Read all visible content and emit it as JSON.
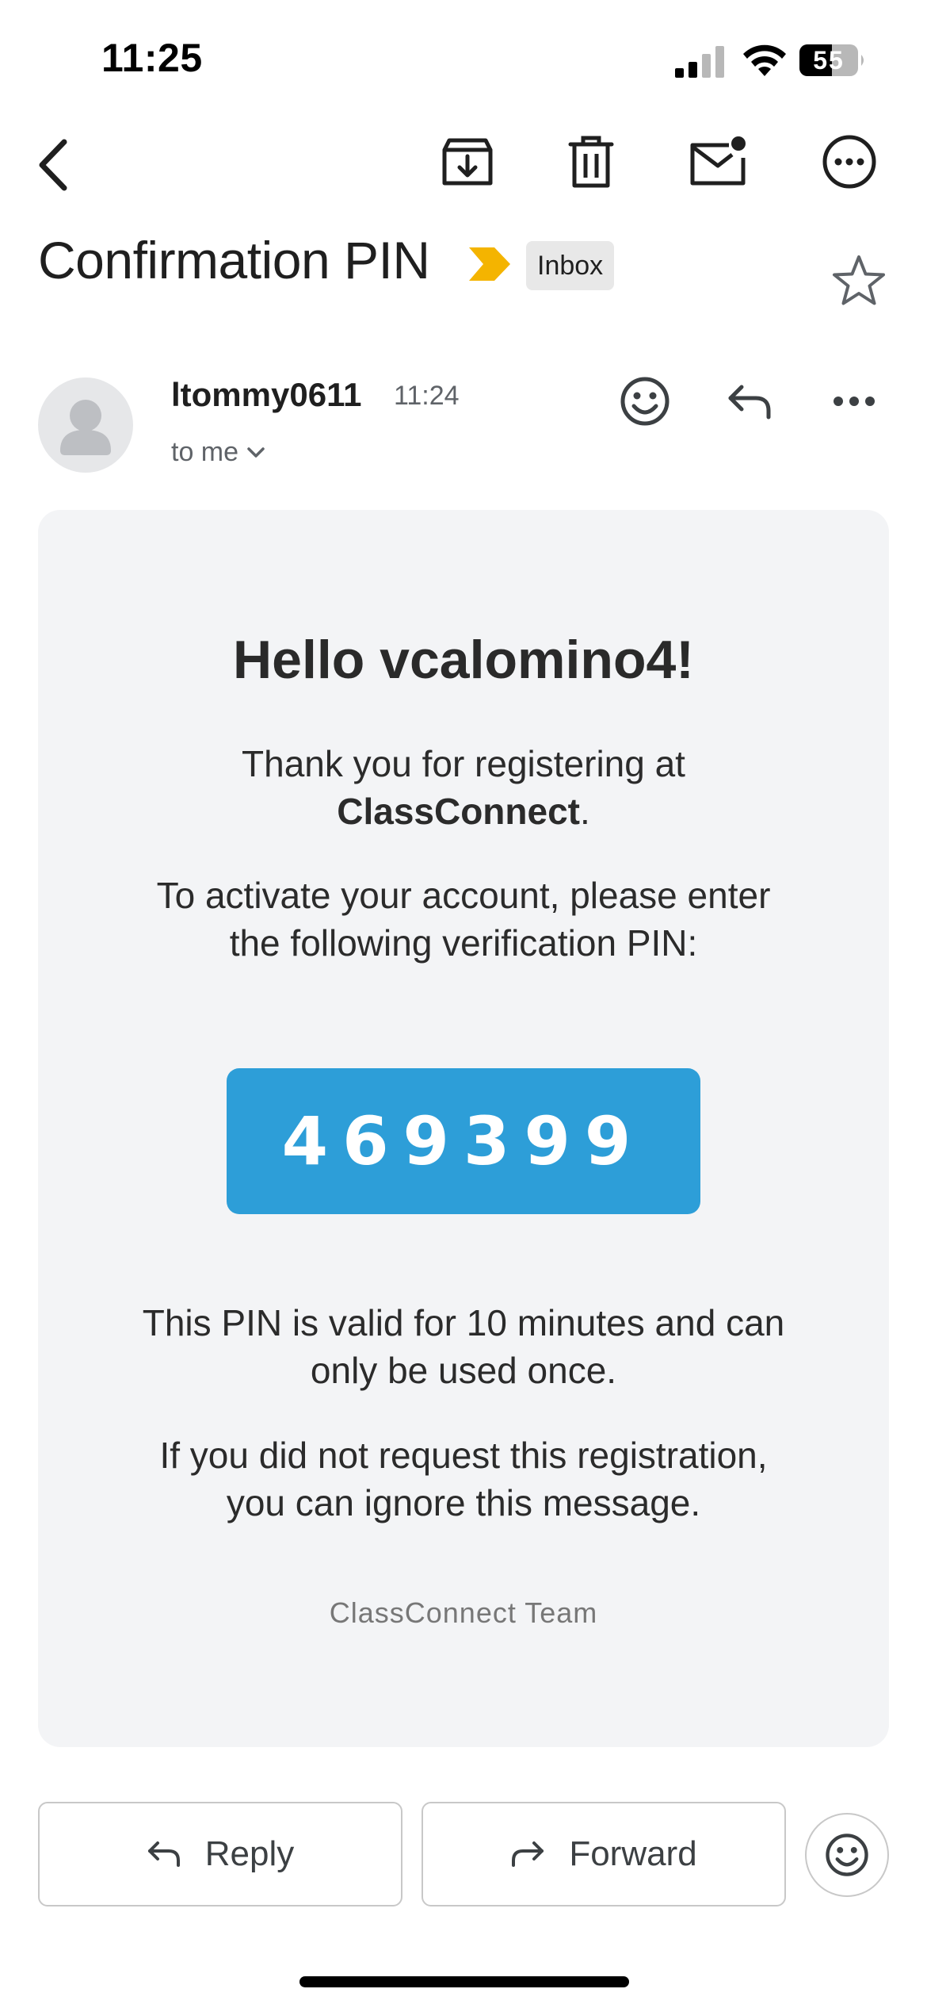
{
  "status_bar": {
    "time": "11:25",
    "battery": "55"
  },
  "toolbar": {
    "back": "back",
    "archive": "archive",
    "delete": "delete",
    "mark_unread": "mark unread",
    "more": "more options"
  },
  "email": {
    "subject": "Confirmation PIN",
    "label": "Inbox",
    "sender": "ltommy0611",
    "time": "11:24",
    "recipient": "to me"
  },
  "body": {
    "greeting": "Hello vcalomino4!",
    "thanks_line1": "Thank you for registering at",
    "brand": "ClassConnect",
    "brand_suffix": ".",
    "activate_line1": "To activate your account, please enter",
    "activate_line2": "the following verification PIN:",
    "pin": "469399",
    "valid_line1": "This PIN is valid for 10 minutes and can",
    "valid_line2": "only be used once.",
    "ignore_line1": "If you did not request this registration,",
    "ignore_line2": "you can ignore this message.",
    "signature": "ClassConnect Team"
  },
  "actions": {
    "reply": "Reply",
    "forward": "Forward"
  },
  "colors": {
    "pin_background": "#2d9ed8",
    "importance": "#f4b400",
    "card": "#f3f4f6"
  },
  "icons": [
    "back-arrow-icon",
    "archive-icon",
    "trash-icon",
    "mail-unread-icon",
    "more-circle-icon",
    "importance-icon",
    "star-icon",
    "avatar-icon",
    "smiley-icon",
    "reply-icon",
    "more-horizontal-icon",
    "chevron-down-icon",
    "forward-icon"
  ]
}
